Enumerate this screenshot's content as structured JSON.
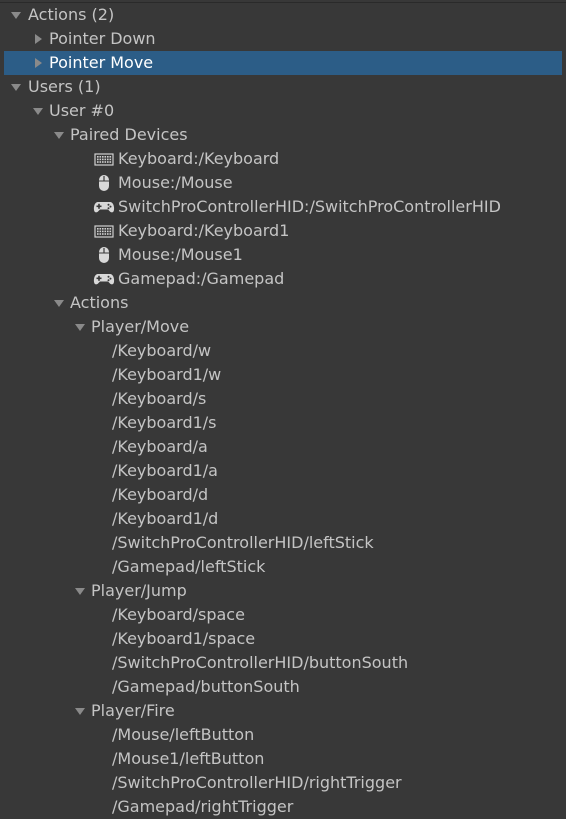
{
  "colors": {
    "background": "#383838",
    "text": "#c4c4c4",
    "selection": "#2c5d87",
    "arrow": "#8a8a8a"
  },
  "tree": {
    "actions_group": {
      "label": "Actions (2)",
      "children": [
        {
          "label": "Pointer Down",
          "expanded": false,
          "selected": false
        },
        {
          "label": "Pointer Move",
          "expanded": false,
          "selected": true
        }
      ]
    },
    "users_group": {
      "label": "Users (1)",
      "user": {
        "label": "User #0",
        "paired_devices": {
          "label": "Paired Devices",
          "devices": [
            {
              "icon": "keyboard-icon",
              "label": "Keyboard:/Keyboard"
            },
            {
              "icon": "mouse-icon",
              "label": "Mouse:/Mouse"
            },
            {
              "icon": "gamepad-icon",
              "label": "SwitchProControllerHID:/SwitchProControllerHID"
            },
            {
              "icon": "keyboard-icon",
              "label": "Keyboard:/Keyboard1"
            },
            {
              "icon": "mouse-icon",
              "label": "Mouse:/Mouse1"
            },
            {
              "icon": "gamepad-icon",
              "label": "Gamepad:/Gamepad"
            }
          ]
        },
        "actions": {
          "label": "Actions",
          "items": [
            {
              "label": "Player/Move",
              "bindings": [
                "/Keyboard/w",
                "/Keyboard1/w",
                "/Keyboard/s",
                "/Keyboard1/s",
                "/Keyboard/a",
                "/Keyboard1/a",
                "/Keyboard/d",
                "/Keyboard1/d",
                "/SwitchProControllerHID/leftStick",
                "/Gamepad/leftStick"
              ]
            },
            {
              "label": "Player/Jump",
              "bindings": [
                "/Keyboard/space",
                "/Keyboard1/space",
                "/SwitchProControllerHID/buttonSouth",
                "/Gamepad/buttonSouth"
              ]
            },
            {
              "label": "Player/Fire",
              "bindings": [
                "/Mouse/leftButton",
                "/Mouse1/leftButton",
                "/SwitchProControllerHID/rightTrigger",
                "/Gamepad/rightTrigger"
              ]
            }
          ]
        }
      }
    }
  }
}
